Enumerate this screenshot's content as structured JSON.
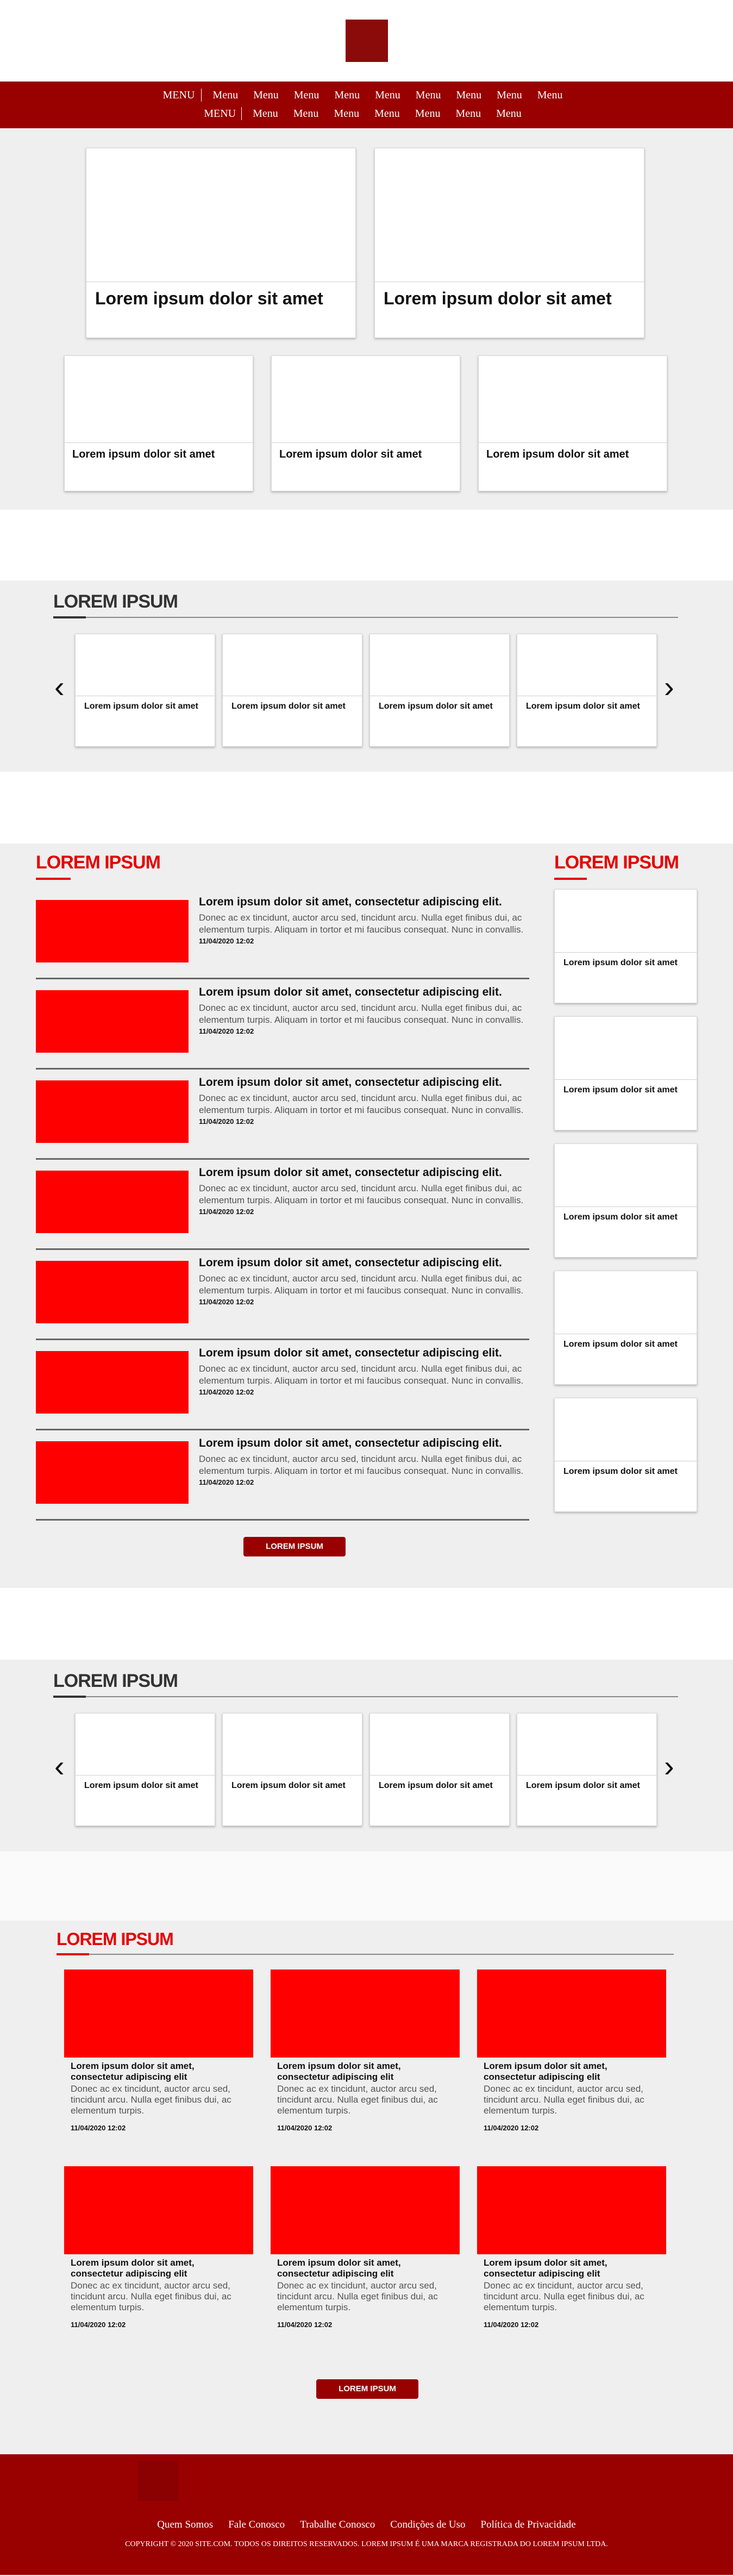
{
  "nav": {
    "menu_label": "MENU",
    "row1": [
      "Menu",
      "Menu",
      "Menu",
      "Menu",
      "Menu",
      "Menu",
      "Menu",
      "Menu",
      "Menu"
    ],
    "row2": [
      "Menu",
      "Menu",
      "Menu",
      "Menu",
      "Menu",
      "Menu",
      "Menu"
    ]
  },
  "hero": {
    "big": [
      "Lorem ipsum dolor sit amet",
      "Lorem ipsum dolor sit amet"
    ],
    "small": [
      "Lorem ipsum dolor sit amet",
      "Lorem ipsum dolor sit amet",
      "Lorem ipsum dolor sit amet"
    ]
  },
  "carousel1": {
    "heading": "LOREM IPSUM",
    "prev": "‹",
    "next": "›",
    "cards": [
      "Lorem ipsum dolor sit amet",
      "Lorem ipsum dolor sit amet",
      "Lorem ipsum dolor sit amet",
      "Lorem ipsum dolor sit amet"
    ]
  },
  "news": {
    "heading": "LOREM IPSUM",
    "items": [
      {
        "title": "Lorem ipsum dolor sit amet, consectetur adipiscing elit.",
        "desc": "Donec ac ex tincidunt, auctor arcu sed, tincidunt arcu. Nulla eget finibus dui, ac elementum turpis. Aliquam in tortor et mi faucibus consequat. Nunc in convallis.",
        "date": "11/04/2020 12:02"
      },
      {
        "title": "Lorem ipsum dolor sit amet, consectetur adipiscing elit.",
        "desc": "Donec ac ex tincidunt, auctor arcu sed, tincidunt arcu. Nulla eget finibus dui, ac elementum turpis. Aliquam in tortor et mi faucibus consequat. Nunc in convallis.",
        "date": "11/04/2020 12:02"
      },
      {
        "title": "Lorem ipsum dolor sit amet, consectetur adipiscing elit.",
        "desc": "Donec ac ex tincidunt, auctor arcu sed, tincidunt arcu. Nulla eget finibus dui, ac elementum turpis. Aliquam in tortor et mi faucibus consequat. Nunc in convallis.",
        "date": "11/04/2020 12:02"
      },
      {
        "title": "Lorem ipsum dolor sit amet, consectetur adipiscing elit.",
        "desc": "Donec ac ex tincidunt, auctor arcu sed, tincidunt arcu. Nulla eget finibus dui, ac elementum turpis. Aliquam in tortor et mi faucibus consequat. Nunc in convallis.",
        "date": "11/04/2020 12:02"
      },
      {
        "title": "Lorem ipsum dolor sit amet, consectetur adipiscing elit.",
        "desc": "Donec ac ex tincidunt, auctor arcu sed, tincidunt arcu. Nulla eget finibus dui, ac elementum turpis. Aliquam in tortor et mi faucibus consequat. Nunc in convallis.",
        "date": "11/04/2020 12:02"
      },
      {
        "title": "Lorem ipsum dolor sit amet, consectetur adipiscing elit.",
        "desc": "Donec ac ex tincidunt, auctor arcu sed, tincidunt arcu. Nulla eget finibus dui, ac elementum turpis. Aliquam in tortor et mi faucibus consequat. Nunc in convallis.",
        "date": "11/04/2020 12:02"
      },
      {
        "title": "Lorem ipsum dolor sit amet, consectetur adipiscing elit.",
        "desc": "Donec ac ex tincidunt, auctor arcu sed, tincidunt arcu. Nulla eget finibus dui, ac elementum turpis. Aliquam in tortor et mi faucibus consequat. Nunc in convallis.",
        "date": "11/04/2020 12:02"
      }
    ],
    "button": "LOREM IPSUM"
  },
  "sidebar": {
    "heading": "LOREM IPSUM",
    "cards": [
      "Lorem ipsum dolor sit amet",
      "Lorem ipsum dolor sit amet",
      "Lorem ipsum dolor sit amet",
      "Lorem ipsum dolor sit amet",
      "Lorem ipsum dolor sit amet"
    ]
  },
  "carousel2": {
    "heading": "LOREM IPSUM",
    "prev": "‹",
    "next": "›",
    "cards": [
      "Lorem ipsum dolor sit amet",
      "Lorem ipsum dolor sit amet",
      "Lorem ipsum dolor sit amet",
      "Lorem ipsum dolor sit amet"
    ]
  },
  "grid": {
    "heading": "LOREM IPSUM",
    "items": [
      {
        "title": "Lorem ipsum dolor sit amet, consectetur adipiscing elit",
        "desc": "Donec ac ex tincidunt, auctor arcu sed, tincidunt arcu. Nulla eget finibus dui, ac elementum turpis.",
        "date": "11/04/2020 12:02"
      },
      {
        "title": "Lorem ipsum dolor sit amet, consectetur adipiscing elit",
        "desc": "Donec ac ex tincidunt, auctor arcu sed, tincidunt arcu. Nulla eget finibus dui, ac elementum turpis.",
        "date": "11/04/2020 12:02"
      },
      {
        "title": "Lorem ipsum dolor sit amet, consectetur adipiscing elit",
        "desc": "Donec ac ex tincidunt, auctor arcu sed, tincidunt arcu. Nulla eget finibus dui, ac elementum turpis.",
        "date": "11/04/2020 12:02"
      },
      {
        "title": "Lorem ipsum dolor sit amet, consectetur adipiscing elit",
        "desc": "Donec ac ex tincidunt, auctor arcu sed, tincidunt arcu. Nulla eget finibus dui, ac elementum turpis.",
        "date": "11/04/2020 12:02"
      },
      {
        "title": "Lorem ipsum dolor sit amet, consectetur adipiscing elit",
        "desc": "Donec ac ex tincidunt, auctor arcu sed, tincidunt arcu. Nulla eget finibus dui, ac elementum turpis.",
        "date": "11/04/2020 12:02"
      },
      {
        "title": "Lorem ipsum dolor sit amet, consectetur adipiscing elit",
        "desc": "Donec ac ex tincidunt, auctor arcu sed, tincidunt arcu. Nulla eget finibus dui, ac elementum turpis.",
        "date": "11/04/2020 12:02"
      }
    ],
    "button": "LOREM IPSUM"
  },
  "footer": {
    "links": [
      "Quem Somos",
      "Fale Conosco",
      "Trabalhe Conosco",
      "Condições de Uso",
      "Política de Privacidade"
    ],
    "copyright": "COPYRIGHT © 2020 SITE.COM. TODOS OS DIREITOS RESERVADOS. LOREM IPSUM É UMA MARCA REGISTRADA DO LOREM IPSUM LTDA."
  },
  "colors": {
    "brand_red": "#990000",
    "accent_red": "#e60000",
    "thumb_red": "#ff0000",
    "logo": "#8b0a0a",
    "section_gray": "#efefef"
  }
}
